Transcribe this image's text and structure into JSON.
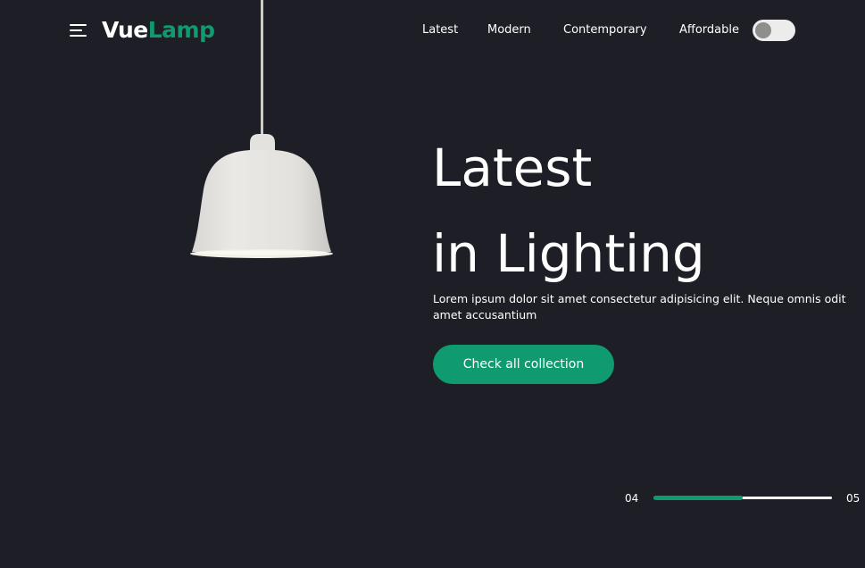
{
  "header": {
    "logo_part1": "Vue",
    "logo_part2": "Lamp",
    "nav": [
      {
        "label": "Latest"
      },
      {
        "label": "Modern"
      },
      {
        "label": "Contemporary"
      },
      {
        "label": "Affordable"
      }
    ],
    "theme_toggle_on": false
  },
  "hero": {
    "title_line1": "Latest",
    "title_line2": "in Lighting",
    "description": "Lorem ipsum dolor sit amet consectetur adipisicing elit. Neque omnis odit amet accusantium",
    "cta_label": "Check all collection"
  },
  "slider": {
    "current": "04",
    "total": "05",
    "progress_fraction": 0.5
  },
  "colors": {
    "background": "#1e1f26",
    "accent": "#0f9a6f",
    "text": "#ffffff",
    "lamp_shade": "#e8e6e2"
  },
  "icons": {
    "menu": "hamburger-menu-icon"
  }
}
